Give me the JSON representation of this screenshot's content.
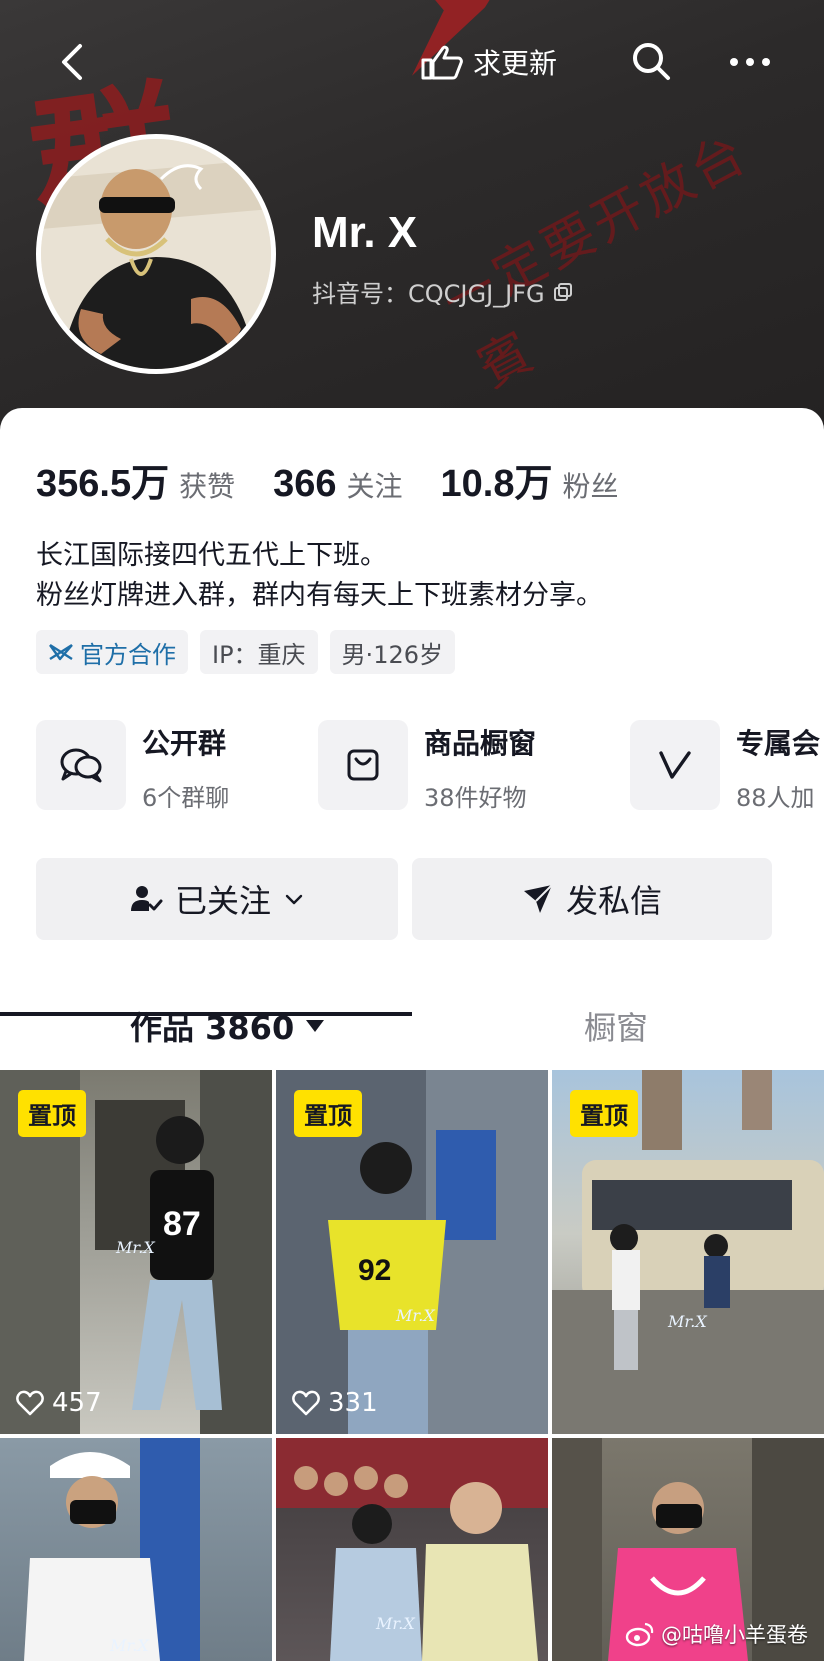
{
  "header": {
    "refresh_label": "求更新",
    "banner_glyph_1": "群",
    "banner_stamp": "一定要开放台賓"
  },
  "profile": {
    "nickname": "Mr. X",
    "douyin_id": "抖音号：CQCJGJ_JFG"
  },
  "stats": [
    {
      "value": "356.5万",
      "label": "获赞"
    },
    {
      "value": "366",
      "label": "关注"
    },
    {
      "value": "10.8万",
      "label": "粉丝"
    }
  ],
  "bio": {
    "line1": "长江国际接四代五代上下班。",
    "line2": "粉丝灯牌进入群，群内有每天上下班素材分享。"
  },
  "tags": {
    "official": "官方合作",
    "ip": "IP：重庆",
    "gender_age": "男·126岁"
  },
  "features": [
    {
      "title": "公开群",
      "subtitle": "6个群聊",
      "icon": "chat-bubbles-icon"
    },
    {
      "title": "商品橱窗",
      "subtitle": "38件好物",
      "icon": "shopping-bag-icon"
    },
    {
      "title": "专属会",
      "subtitle": "88人加",
      "icon": "v-badge-icon"
    }
  ],
  "actions": {
    "follow": "已关注",
    "message": "发私信"
  },
  "tabs": {
    "works": "作品 3860",
    "shop": "橱窗"
  },
  "videos": [
    {
      "pinned_label": "置顶",
      "likes": "457",
      "watermark": "Mr.X"
    },
    {
      "pinned_label": "置顶",
      "likes": "331",
      "watermark": "Mr.X"
    },
    {
      "pinned_label": "置顶",
      "likes": "",
      "watermark": "Mr.X"
    },
    {
      "pinned_label": "",
      "likes": "",
      "watermark": "Mr.X"
    },
    {
      "pinned_label": "",
      "likes": "",
      "watermark": "Mr.X"
    },
    {
      "pinned_label": "",
      "likes": "",
      "watermark": ""
    }
  ],
  "watermark": "@咕噜小羊蛋卷",
  "colors": {
    "banner_bg": "#2c2a2a",
    "pin_yellow": "#ffe100",
    "official_blue": "#1f6fa8",
    "text_primary": "#161823",
    "text_secondary": "#6b6d73"
  }
}
